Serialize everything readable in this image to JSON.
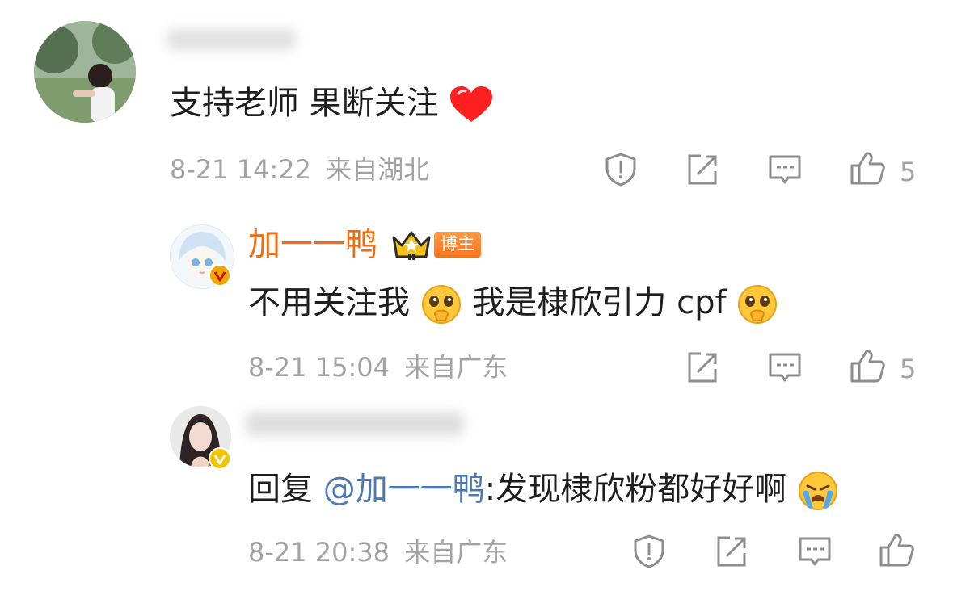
{
  "comments": [
    {
      "text": "支持老师 果断关注",
      "emoji": "heart",
      "time": "8-21 14:22",
      "location": "来自湖北",
      "likes": "5"
    }
  ],
  "replies": [
    {
      "name": "加一一鸭",
      "badge": "博主",
      "text_part1": "不用关注我",
      "text_part2": "我是棣欣引力 cpf",
      "emoji": "pleading-face",
      "time": "8-21 15:04",
      "location": "来自广东",
      "likes": "5"
    },
    {
      "reply_prefix": "回复",
      "mention": "@加一一鸭",
      "text": ":发现棣欣粉都好好啊",
      "emoji": "crying-face",
      "time": "8-21 20:38",
      "location": "来自广东"
    }
  ],
  "colors": {
    "brand_orange": "#f26b0f",
    "mention_blue": "#4c79b1",
    "meta_gray": "#a3a3a3",
    "verified_gold": "#f3a600"
  },
  "icons": [
    "report-icon",
    "share-icon",
    "comment-icon",
    "like-icon"
  ]
}
